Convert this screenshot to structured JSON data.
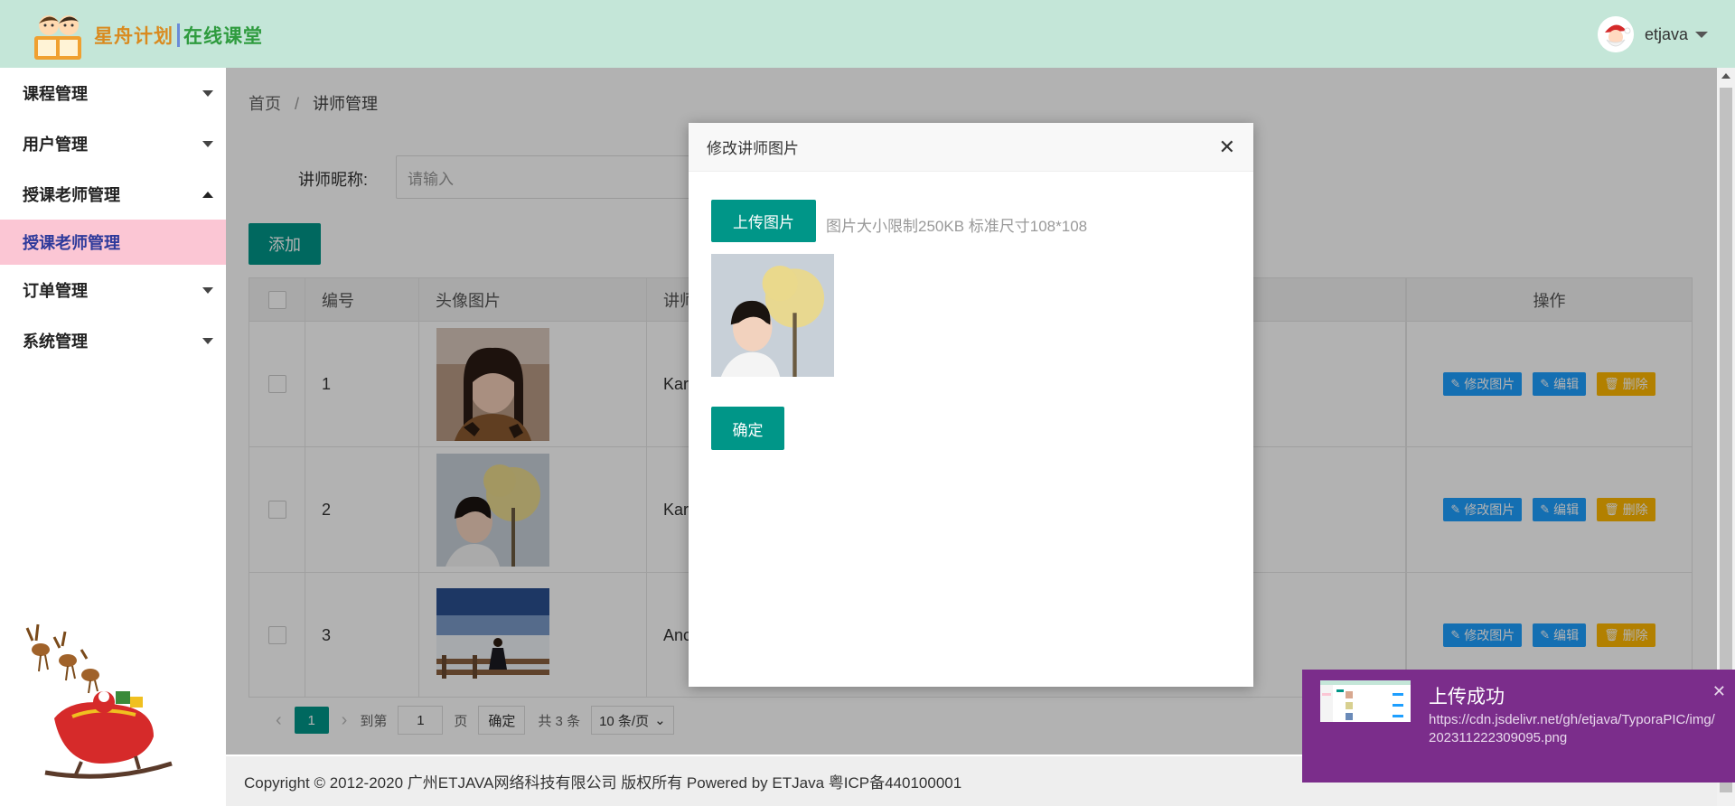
{
  "header": {
    "logo_text_1": "星舟计划",
    "logo_text_2": "在线课堂",
    "username": "etjava"
  },
  "sidebar": {
    "items": [
      {
        "label": "课程管理",
        "expanded": false
      },
      {
        "label": "用户管理",
        "expanded": false
      },
      {
        "label": "授课老师管理",
        "expanded": true,
        "children": [
          {
            "label": "授课老师管理",
            "active": true
          }
        ]
      },
      {
        "label": "订单管理",
        "expanded": false
      },
      {
        "label": "系统管理",
        "expanded": false
      }
    ]
  },
  "breadcrumb": {
    "home": "首页",
    "sep": "/",
    "current": "讲师管理"
  },
  "search": {
    "label": "讲师昵称:",
    "placeholder": "请输入"
  },
  "toolbar": {
    "add_label": "添加"
  },
  "table": {
    "columns": [
      "编号",
      "头像图片",
      "讲师",
      "操作"
    ],
    "rows": [
      {
        "id": "1",
        "name": "Karc"
      },
      {
        "id": "2",
        "name": "Karc"
      },
      {
        "id": "3",
        "name": "Anc"
      }
    ],
    "actions": {
      "edit_image": "修改图片",
      "edit": "编辑",
      "delete": "删除"
    }
  },
  "pagination": {
    "current_page": "1",
    "goto_prefix": "到第",
    "goto_value": "1",
    "goto_suffix": "页",
    "confirm": "确定",
    "total": "共 3 条",
    "page_size": "10 条/页"
  },
  "footer": {
    "text": "Copyright © 2012-2020 广州ETJAVA网络科技有限公司 版权所有 Powered by ETJava 粤ICP备440100001"
  },
  "modal": {
    "title": "修改讲师图片",
    "upload_label": "上传图片",
    "upload_tip": "图片大小限制250KB 标准尺寸108*108",
    "confirm_label": "确定"
  },
  "toast": {
    "title": "上传成功",
    "body": "https://cdn.jsdelivr.net/gh/etjava/TyporaPIC/img/202311222309095.png"
  },
  "colors": {
    "header_bg": "#c4e6d8",
    "primary": "#009688",
    "active_nav_bg": "#fbc6d4",
    "btn_blue": "#1e9fff",
    "btn_orange": "#ffb800",
    "toast_bg": "#7b2d8b"
  }
}
